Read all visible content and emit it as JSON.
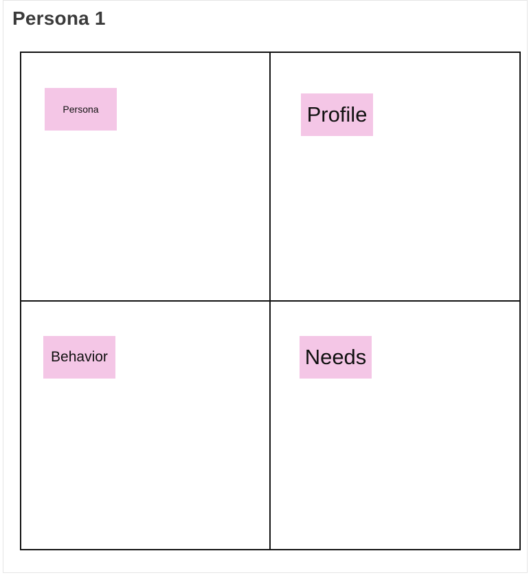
{
  "frame": {
    "title": "Persona 1"
  },
  "board": {
    "quadrants": [
      {
        "sticky_label": "Persona"
      },
      {
        "sticky_label": "Profile"
      },
      {
        "sticky_label": "Behavior"
      },
      {
        "sticky_label": "Needs"
      }
    ],
    "sticky_color": "#f4c6e6",
    "grid_line_color": "#111111"
  }
}
